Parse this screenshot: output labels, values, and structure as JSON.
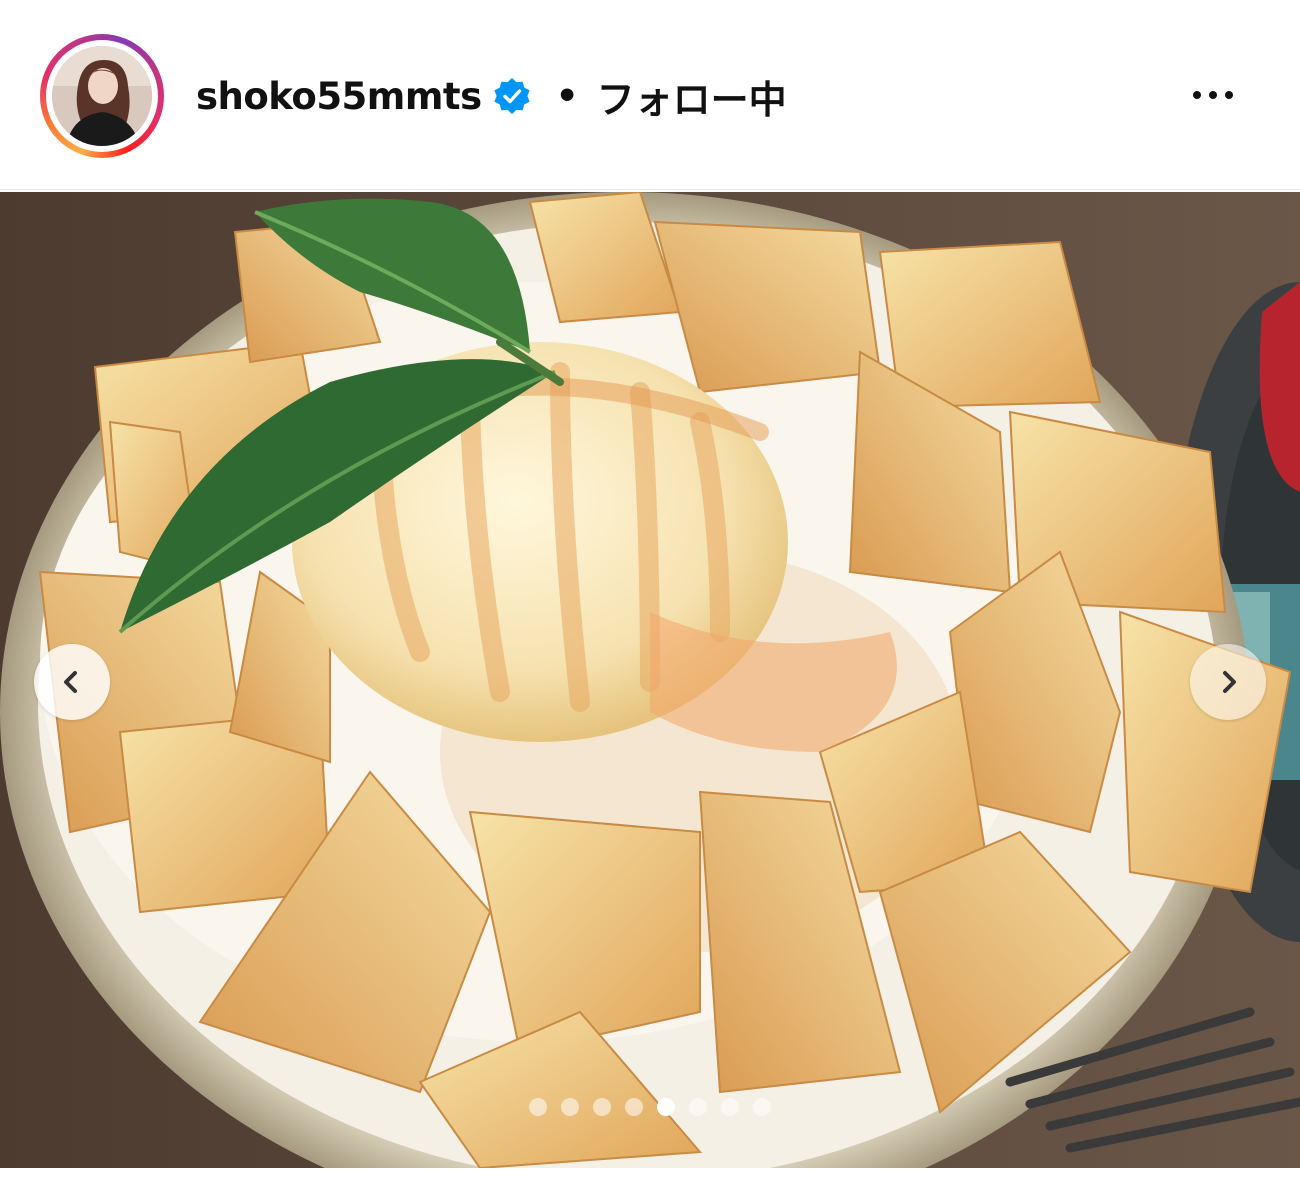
{
  "header": {
    "username": "shoko55mmts",
    "separator": "•",
    "follow_status": "フォロー中"
  },
  "icons": {
    "verified": "verified-badge-icon",
    "more": "more-options-icon",
    "prev": "chevron-left-icon",
    "next": "chevron-right-icon"
  },
  "colors": {
    "verified_blue": "#0095f6",
    "text": "#111111"
  },
  "carousel": {
    "total_slides": 8,
    "active_slide": 5
  }
}
